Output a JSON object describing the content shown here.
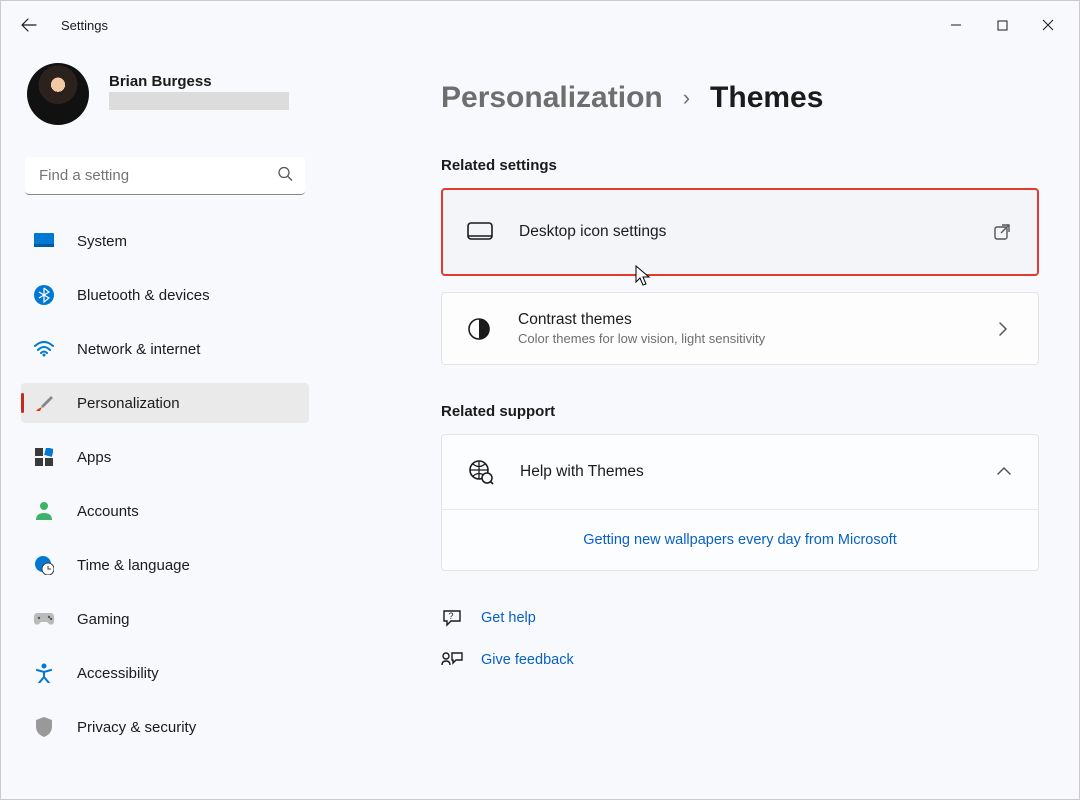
{
  "app": {
    "title": "Settings"
  },
  "user": {
    "name": "Brian Burgess"
  },
  "search": {
    "placeholder": "Find a setting"
  },
  "sidebar": {
    "items": [
      {
        "label": "System"
      },
      {
        "label": "Bluetooth & devices"
      },
      {
        "label": "Network & internet"
      },
      {
        "label": "Personalization"
      },
      {
        "label": "Apps"
      },
      {
        "label": "Accounts"
      },
      {
        "label": "Time & language"
      },
      {
        "label": "Gaming"
      },
      {
        "label": "Accessibility"
      },
      {
        "label": "Privacy & security"
      }
    ]
  },
  "breadcrumb": {
    "parent": "Personalization",
    "current": "Themes"
  },
  "related_settings": {
    "heading": "Related settings",
    "desktop_icon": {
      "title": "Desktop icon settings"
    },
    "contrast": {
      "title": "Contrast themes",
      "subtitle": "Color themes for low vision, light sensitivity"
    }
  },
  "related_support": {
    "heading": "Related support",
    "help_themes": {
      "title": "Help with Themes"
    },
    "wallpapers_link": "Getting new wallpapers every day from Microsoft"
  },
  "footer_links": {
    "get_help": "Get help",
    "give_feedback": "Give feedback"
  }
}
